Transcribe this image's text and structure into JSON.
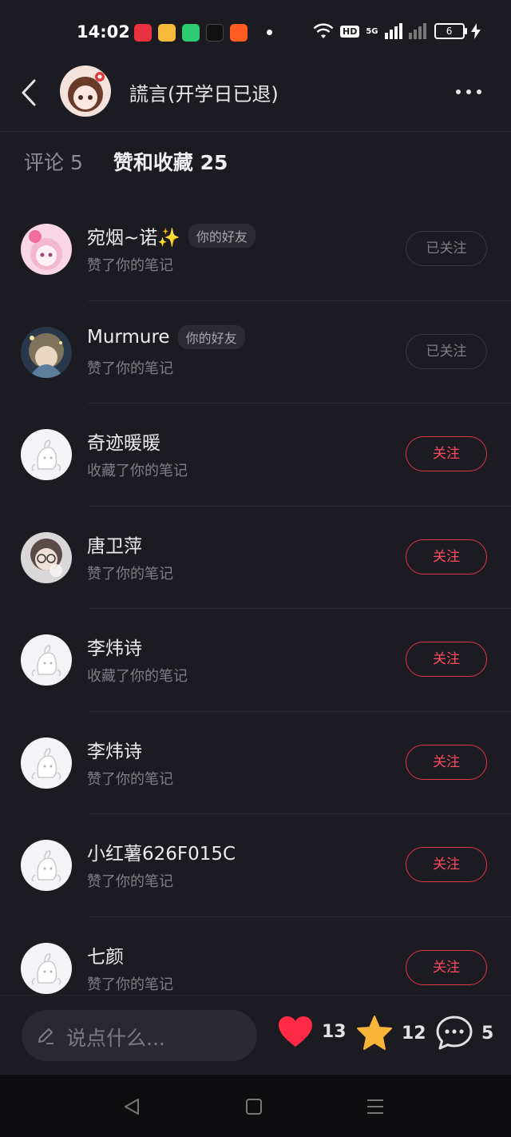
{
  "status_bar": {
    "time": "14:02",
    "app_icons": [
      {
        "name": "xiaohongshu-icon",
        "color": "#e8323f"
      },
      {
        "name": "weibo-icon",
        "color": "#f6b93b"
      },
      {
        "name": "phone-icon",
        "color": "#2ecc71"
      },
      {
        "name": "tiktok-icon",
        "color": "#111111"
      },
      {
        "name": "kuaishou-icon",
        "color": "#ff5a1f"
      }
    ],
    "hd_label": "HD",
    "network_label": "5G",
    "battery": "6"
  },
  "header": {
    "title": "謊言(开学日已退)"
  },
  "tabs": [
    {
      "label": "评论 5",
      "active": false
    },
    {
      "label": "赞和收藏 25",
      "active": true
    }
  ],
  "notifications": [
    {
      "name": "宛烟~诺✨",
      "tag": "你的好友",
      "action": "赞了你的笔记",
      "button": "已关注",
      "followed": true,
      "avatar": "pink"
    },
    {
      "name": "Murmure",
      "tag": "你的好友",
      "action": "赞了你的笔记",
      "button": "已关注",
      "followed": true,
      "avatar": "blue"
    },
    {
      "name": "奇迹暖暖",
      "tag": "",
      "action": "收藏了你的笔记",
      "button": "关注",
      "followed": false,
      "avatar": "default"
    },
    {
      "name": "唐卫萍",
      "tag": "",
      "action": "赞了你的笔记",
      "button": "关注",
      "followed": false,
      "avatar": "photo"
    },
    {
      "name": "李炜诗",
      "tag": "",
      "action": "收藏了你的笔记",
      "button": "关注",
      "followed": false,
      "avatar": "default"
    },
    {
      "name": "李炜诗",
      "tag": "",
      "action": "赞了你的笔记",
      "button": "关注",
      "followed": false,
      "avatar": "default"
    },
    {
      "name": "小红薯626F015C",
      "tag": "",
      "action": "赞了你的笔记",
      "button": "关注",
      "followed": false,
      "avatar": "default"
    },
    {
      "name": "七颜",
      "tag": "",
      "action": "赞了你的笔记",
      "button": "关注",
      "followed": false,
      "avatar": "default"
    }
  ],
  "bottom_bar": {
    "comment_placeholder": "说点什么...",
    "likes": "13",
    "collects": "12",
    "comments": "5"
  },
  "colors": {
    "background": "#1c1b21",
    "accent": "#ff4b62",
    "heart": "#ff2a45",
    "star": "#f9b43a"
  }
}
